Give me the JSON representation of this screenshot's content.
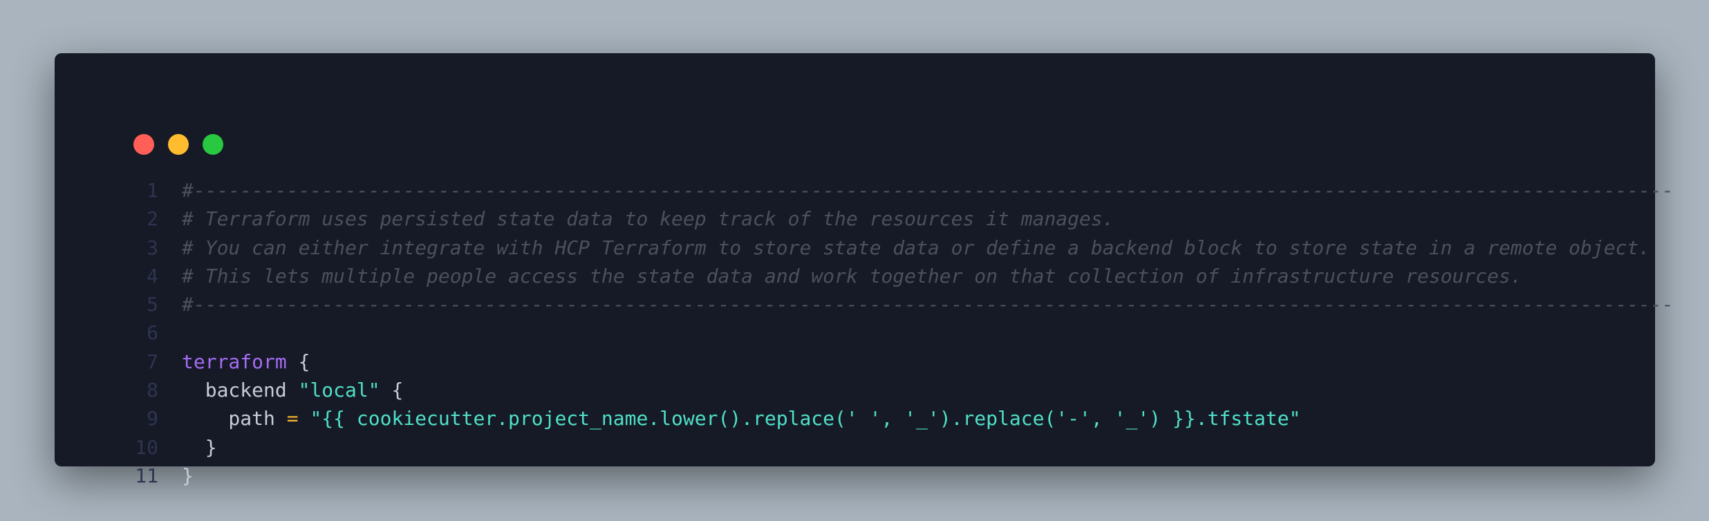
{
  "window": {
    "controls": [
      "close",
      "minimize",
      "maximize"
    ],
    "colors": {
      "close": "#ff5f57",
      "minimize": "#febc2e",
      "maximize": "#28c840"
    }
  },
  "code": {
    "lines": [
      {
        "number": "1",
        "tokens": [
          {
            "type": "comment",
            "text": "#-------------------------------------------------------------------------------------------------------------------------------"
          }
        ]
      },
      {
        "number": "2",
        "tokens": [
          {
            "type": "comment",
            "text": "# Terraform uses persisted state data to keep track of the resources it manages."
          }
        ]
      },
      {
        "number": "3",
        "tokens": [
          {
            "type": "comment",
            "text": "# You can either integrate with HCP Terraform to store state data or define a backend block to store state in a remote object."
          }
        ]
      },
      {
        "number": "4",
        "tokens": [
          {
            "type": "comment",
            "text": "# This lets multiple people access the state data and work together on that collection of infrastructure resources."
          }
        ]
      },
      {
        "number": "5",
        "tokens": [
          {
            "type": "comment",
            "text": "#-------------------------------------------------------------------------------------------------------------------------------"
          }
        ]
      },
      {
        "number": "6",
        "tokens": []
      },
      {
        "number": "7",
        "tokens": [
          {
            "type": "kw",
            "text": "terraform"
          },
          {
            "type": "plain",
            "text": " {"
          }
        ]
      },
      {
        "number": "8",
        "tokens": [
          {
            "type": "plain",
            "text": "  backend "
          },
          {
            "type": "str",
            "text": "\"local\""
          },
          {
            "type": "plain",
            "text": " {"
          }
        ]
      },
      {
        "number": "9",
        "tokens": [
          {
            "type": "plain",
            "text": "    path "
          },
          {
            "type": "op",
            "text": "="
          },
          {
            "type": "plain",
            "text": " "
          },
          {
            "type": "str",
            "text": "\"{{ cookiecutter.project_name.lower().replace(' ', '_').replace('-', '_') }}.tfstate\""
          }
        ]
      },
      {
        "number": "10",
        "tokens": [
          {
            "type": "plain",
            "text": "  }"
          }
        ]
      },
      {
        "number": "11",
        "tokens": [
          {
            "type": "plain",
            "text": "}"
          }
        ]
      }
    ]
  }
}
